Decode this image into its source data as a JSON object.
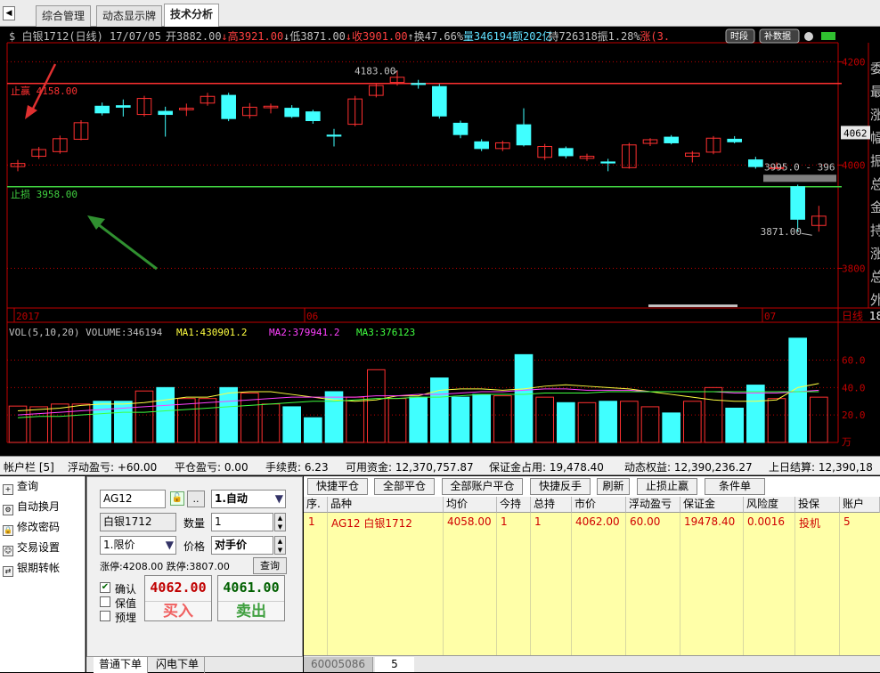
{
  "tabs": [
    "综合管理",
    "动态显示牌",
    "技术分析"
  ],
  "chart_info": {
    "symbol": "$ 白银1712(日线) 17/07/05",
    "fields": [
      {
        "label": "开",
        "value": "3882.00",
        "color": "#c0c0c0"
      },
      {
        "label": "↓高",
        "value": "3921.00",
        "color": "#ff4040"
      },
      {
        "label": "↓低",
        "value": "3871.00",
        "color": "#c0c0c0"
      },
      {
        "label": "↓收",
        "value": "3901.00",
        "color": "#ff4040"
      },
      {
        "label": "↑换",
        "value": "47.66%",
        "color": "#c0c0c0"
      },
      {
        "label": "量",
        "value": "346194",
        "color": "#60e0ff"
      },
      {
        "label": "额",
        "value": "202亿",
        "color": "#60e0ff"
      },
      {
        "label": "持",
        "value": "726318",
        "color": "#c0c0c0"
      },
      {
        "label": "振",
        "value": "1.28%",
        "color": "#c0c0c0"
      },
      {
        "label": "涨",
        "value": "(3.",
        "color": "#ff4040"
      }
    ],
    "btn_period": "时段",
    "btn_data": "补数据"
  },
  "right_panel": [
    "委",
    "最",
    "涨",
    "幅",
    "振",
    "总",
    "金",
    "持",
    "涨",
    "总",
    "外"
  ],
  "price_ticks": [
    "4200",
    "4000",
    "3800"
  ],
  "vol_ticks": [
    "60.0",
    "40.0",
    "20.0"
  ],
  "vol_unit": "万",
  "date_ticks": [
    "2017",
    "06",
    "07"
  ],
  "period_label": "日线",
  "take_profit": {
    "label": "止赢 4158.00",
    "value": 4158,
    "color": "#ff3030"
  },
  "stop_loss": {
    "label": "止损 3958.00",
    "value": 3958,
    "color": "#40d040"
  },
  "annotations": {
    "high": "4183.00",
    "low": "3871.00",
    "current": "3995.0 - 396",
    "price_badge": "4062",
    "cut": "18"
  },
  "vol_header": {
    "label": "VOL(5,10,20) VOLUME:346194",
    "ma1": "MA1:430901.2",
    "ma2": "MA2:379941.2",
    "ma3": "MA3:376123",
    "ma1_color": "#ffff40",
    "ma2_color": "#ff40ff",
    "ma3_color": "#40ff40"
  },
  "chart_data": {
    "type": "candlestick",
    "candles": [
      {
        "o": 3997,
        "c": 4003,
        "h": 4010,
        "l": 3988
      },
      {
        "o": 4017,
        "c": 4030,
        "h": 4035,
        "l": 4012
      },
      {
        "o": 4026,
        "c": 4051,
        "h": 4057,
        "l": 4022
      },
      {
        "o": 4050,
        "c": 4082,
        "h": 4087,
        "l": 4048
      },
      {
        "o": 4114,
        "c": 4101,
        "h": 4121,
        "l": 4096
      },
      {
        "o": 4115,
        "c": 4112,
        "h": 4127,
        "l": 4094
      },
      {
        "o": 4098,
        "c": 4129,
        "h": 4134,
        "l": 4094
      },
      {
        "o": 4104,
        "c": 4098,
        "h": 4113,
        "l": 4055
      },
      {
        "o": 4107,
        "c": 4110,
        "h": 4119,
        "l": 4095
      },
      {
        "o": 4120,
        "c": 4133,
        "h": 4140,
        "l": 4115
      },
      {
        "o": 4135,
        "c": 4090,
        "h": 4140,
        "l": 4085
      },
      {
        "o": 4096,
        "c": 4112,
        "h": 4120,
        "l": 4090
      },
      {
        "o": 4111,
        "c": 4114,
        "h": 4119,
        "l": 4100
      },
      {
        "o": 4110,
        "c": 4094,
        "h": 4116,
        "l": 4091
      },
      {
        "o": 4103,
        "c": 4086,
        "h": 4107,
        "l": 4080
      },
      {
        "o": 4058,
        "c": 4056,
        "h": 4070,
        "l": 4036
      },
      {
        "o": 4079,
        "c": 4128,
        "h": 4134,
        "l": 4075
      },
      {
        "o": 4135,
        "c": 4154,
        "h": 4158,
        "l": 4131
      },
      {
        "o": 4160,
        "c": 4170,
        "h": 4183,
        "l": 4154
      },
      {
        "o": 4158,
        "c": 4156,
        "h": 4165,
        "l": 4148
      },
      {
        "o": 4152,
        "c": 4095,
        "h": 4157,
        "l": 4090
      },
      {
        "o": 4081,
        "c": 4059,
        "h": 4086,
        "l": 4052
      },
      {
        "o": 4045,
        "c": 4032,
        "h": 4050,
        "l": 4027
      },
      {
        "o": 4032,
        "c": 4043,
        "h": 4047,
        "l": 4027
      },
      {
        "o": 4078,
        "c": 4039,
        "h": 4110,
        "l": 4036
      },
      {
        "o": 4015,
        "c": 4036,
        "h": 4041,
        "l": 4010
      },
      {
        "o": 4032,
        "c": 4018,
        "h": 4036,
        "l": 4013
      },
      {
        "o": 4013,
        "c": 4017,
        "h": 4022,
        "l": 4008
      },
      {
        "o": 4006,
        "c": 4004,
        "h": 4012,
        "l": 3988
      },
      {
        "o": 3995,
        "c": 4039,
        "h": 4043,
        "l": 3993
      },
      {
        "o": 4042,
        "c": 4049,
        "h": 4052,
        "l": 4037
      },
      {
        "o": 4054,
        "c": 4043,
        "h": 4058,
        "l": 4040
      },
      {
        "o": 4017,
        "c": 4023,
        "h": 4027,
        "l": 4005
      },
      {
        "o": 4025,
        "c": 4052,
        "h": 4056,
        "l": 4021
      },
      {
        "o": 4050,
        "c": 4045,
        "h": 4056,
        "l": 4042
      },
      {
        "o": 4010,
        "c": 3997,
        "h": 4016,
        "l": 3993
      },
      {
        "o": 3995,
        "c": 3995,
        "h": 4005,
        "l": 3992
      },
      {
        "o": 3958,
        "c": 3895,
        "h": 3962,
        "l": 3871
      },
      {
        "o": 3883,
        "c": 3901,
        "h": 3921,
        "l": 3871
      }
    ],
    "volumes": [
      26.5,
      26,
      28,
      28,
      30,
      30,
      37.5,
      40,
      32,
      32,
      40,
      36,
      28,
      26,
      18,
      37,
      33,
      53,
      32,
      33,
      47,
      33,
      35,
      34,
      64,
      33,
      29,
      29,
      30,
      30,
      26,
      21.5,
      30,
      40,
      25,
      41.8,
      32,
      76,
      33
    ],
    "ma1": [
      23,
      24,
      25,
      27,
      28,
      28,
      29,
      31,
      33,
      33,
      36,
      37,
      37,
      35,
      33,
      31,
      30,
      31,
      34,
      34,
      38,
      39,
      39,
      38,
      39,
      41,
      42,
      41,
      40,
      39,
      37,
      35,
      33,
      31,
      30,
      30,
      31,
      40,
      43
    ],
    "ma2": [
      20,
      21,
      22,
      23,
      24,
      25,
      26,
      27,
      28,
      29,
      30,
      31,
      32,
      33,
      33,
      33,
      33,
      34,
      34,
      35,
      35,
      36,
      37,
      37,
      38,
      39,
      39,
      38,
      38,
      38,
      37,
      37,
      37,
      37,
      36,
      36,
      36,
      37,
      38
    ],
    "ma3": [
      18,
      19,
      19,
      20,
      21,
      22,
      22,
      23,
      24,
      25,
      26,
      27,
      28,
      29,
      30,
      30,
      31,
      32,
      32,
      33,
      33,
      34,
      35,
      35,
      35,
      36,
      36,
      36,
      37,
      37,
      37,
      37,
      37,
      37,
      37,
      37,
      37,
      37,
      37
    ],
    "price_range": [
      3730,
      4230
    ],
    "vol_range": [
      0,
      85
    ]
  },
  "account": {
    "title": "帐户栏 [5]",
    "float_pl": "浮动盈亏: +60.00",
    "close_pl": "平仓盈亏: 0.00",
    "fee": "手续费: 6.23",
    "available": "可用资金: 12,370,757.87",
    "margin": "保证金占用: 19,478.40",
    "equity": "动态权益: 12,390,236.27",
    "prev_settle": "上日结算: 12,390,18"
  },
  "leftnav": [
    "查询",
    "自动换月",
    "修改密码",
    "交易设置",
    "银期转帐"
  ],
  "order": {
    "code": "AG12",
    "dots": "..",
    "auto": "1.自动",
    "name": "白银1712",
    "qty_label": "数量",
    "qty": "1",
    "type": "1.限价",
    "price_label": "价格",
    "price": "对手价",
    "limits": "涨停:4208.00 跌停:3807.00",
    "query": "查询",
    "confirm": "确认",
    "hedge": "保值",
    "prebuy": "预埋",
    "buy_price": "4062.00",
    "buy_label": "买入",
    "sell_price": "4061.00",
    "sell_label": "卖出"
  },
  "bottom_tabs": [
    "普通下单",
    "闪电下单"
  ],
  "toolbar": [
    "快捷平仓",
    "全部平仓",
    "全部账户平仓",
    "快捷反手",
    "刷新",
    "止损止赢",
    "条件单"
  ],
  "columns": [
    "序.",
    "品种",
    "均价",
    "今持",
    "总持",
    "市价",
    "浮动盈亏",
    "保证金",
    "风险度",
    "投保",
    "账户"
  ],
  "positions": [
    [
      "1",
      "AG12 白银1712",
      "4058.00",
      "1",
      "1",
      "4062.00",
      "60.00",
      "19478.40",
      "0.0016",
      "投机",
      "5"
    ]
  ],
  "account_tabs": [
    "60005086",
    "5"
  ],
  "colors": {
    "up": "#ff3030",
    "down": "#40ffff",
    "grid": "#c00000"
  }
}
